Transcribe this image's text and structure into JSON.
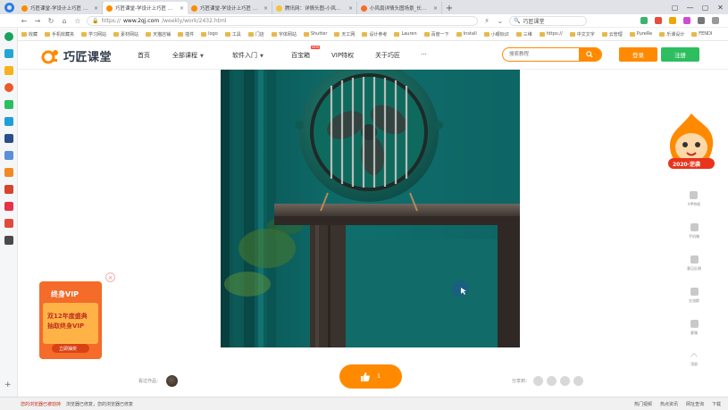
{
  "browser": {
    "tabs": [
      {
        "title": "巧匠课堂-学设计上巧匠 免费IT",
        "active": false
      },
      {
        "title": "巧匠课堂-学设计上巧匠 免费IT",
        "active": true
      },
      {
        "title": "巧匠课堂-学设计上巧匠 免费IT",
        "active": false
      },
      {
        "title": "腾讯网：详情头图-小风扇详情",
        "active": false
      },
      {
        "title": "小风扇详情头图场景_长大观_电气",
        "active": false
      }
    ],
    "new_tab": "+",
    "window_controls": [
      "▢",
      "—",
      "▢",
      "✕"
    ],
    "url_prefix": "https://",
    "url_host": "www.2qj.com",
    "url_path": "/weekly/work/2432.html",
    "search_value": "巧匠课堂",
    "bookmarks": [
      "收藏",
      "手机收藏夹",
      "学习网站",
      "素材网站",
      "天猫店铺",
      "插件",
      "logo",
      "工具",
      "门店",
      "字体网站",
      "Shutter",
      "天工网",
      "设计参考",
      "Lauren",
      "百度一下",
      "Install",
      "小眼标识",
      "三维",
      "https://",
      "中文文字",
      "云管理",
      "PureRe",
      "乐课设计",
      "FENDI"
    ],
    "status_left": [
      "您的浏览器已被劫持",
      "浏览器已修复，您的浏览器已修复"
    ],
    "status_right": [
      "热门视频",
      "热点资讯",
      "网址查询",
      "下载"
    ]
  },
  "site": {
    "logo_text": "巧匠课堂",
    "nav": [
      {
        "label": "首页",
        "has_caret": false
      },
      {
        "label": "全部课程",
        "has_caret": true
      },
      {
        "label": "软件入门",
        "has_caret": true
      },
      {
        "label": "百宝箱",
        "has_caret": false,
        "badge": "NEW"
      },
      {
        "label": "VIP特权",
        "has_caret": false
      },
      {
        "label": "关于巧匠",
        "has_caret": false
      },
      {
        "label": "···",
        "has_caret": false
      }
    ],
    "search_placeholder": "搜索教程",
    "login_label": "登录",
    "register_label": "注册"
  },
  "promo": {
    "vip_title": "终身VIP",
    "vip_line1": "双12年度盛典",
    "vip_line2": "抽取终身VIP",
    "vip_button": "立即抽奖",
    "close": "×",
    "mascot_badge": "2020·逆袭"
  },
  "right_tools": [
    "VIP特权",
    "手机端",
    "意见反馈",
    "交流群",
    "客服",
    "顶部"
  ],
  "actions": {
    "viewers_label": "看过作品：",
    "like_count": "1",
    "share_label": "分享到："
  },
  "colors": {
    "brand_orange": "#ff8a00",
    "register_green": "#2dbe60",
    "teal_wall": "#0e6b6a"
  }
}
